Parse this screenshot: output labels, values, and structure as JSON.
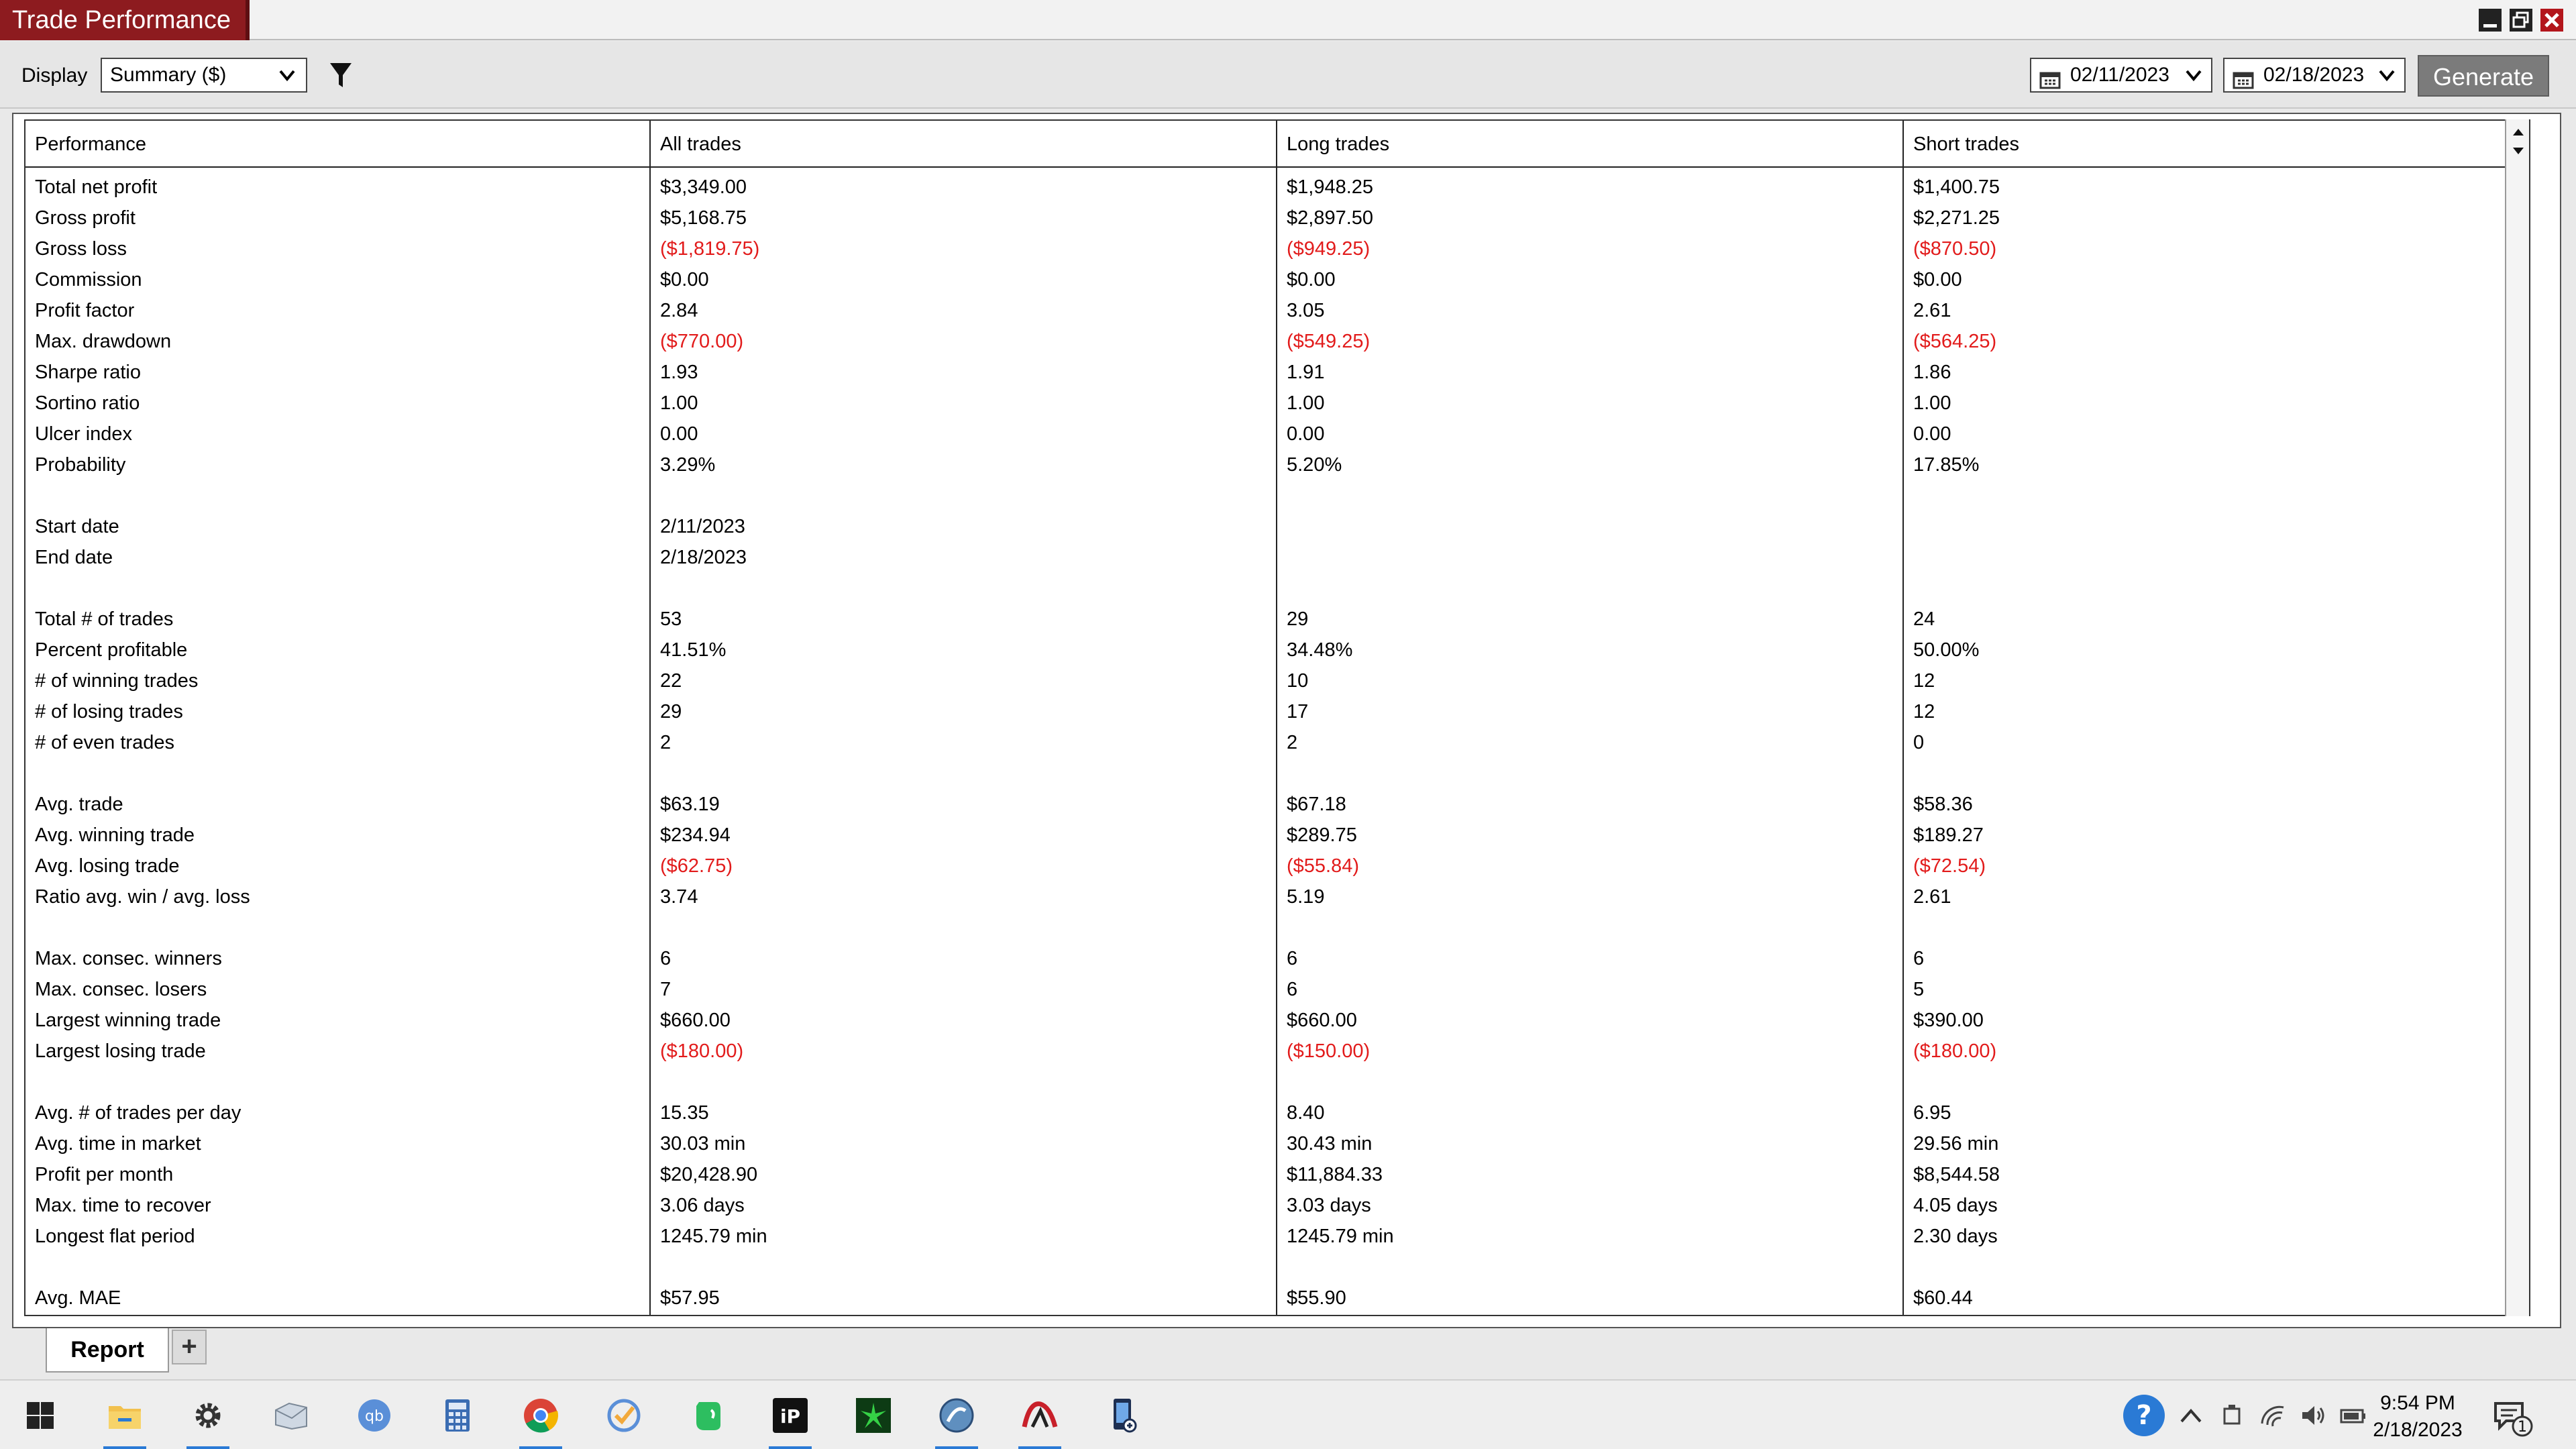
{
  "window": {
    "title": "Trade Performance"
  },
  "toolbar": {
    "display_label": "Display",
    "display_value": "Summary ($)",
    "start_date": "02/11/2023",
    "end_date": "02/18/2023",
    "generate_label": "Generate"
  },
  "table": {
    "headers": [
      "Performance",
      "All trades",
      "Long trades",
      "Short trades"
    ],
    "rows": [
      {
        "label": "Total net profit",
        "all": "$3,349.00",
        "long": "$1,948.25",
        "short": "$1,400.75",
        "neg": false
      },
      {
        "label": "Gross profit",
        "all": "$5,168.75",
        "long": "$2,897.50",
        "short": "$2,271.25",
        "neg": false
      },
      {
        "label": "Gross loss",
        "all": "($1,819.75)",
        "long": "($949.25)",
        "short": "($870.50)",
        "neg": true
      },
      {
        "label": "Commission",
        "all": "$0.00",
        "long": "$0.00",
        "short": "$0.00",
        "neg": false
      },
      {
        "label": "Profit factor",
        "all": "2.84",
        "long": "3.05",
        "short": "2.61",
        "neg": false
      },
      {
        "label": "Max. drawdown",
        "all": "($770.00)",
        "long": "($549.25)",
        "short": "($564.25)",
        "neg": true
      },
      {
        "label": "Sharpe ratio",
        "all": "1.93",
        "long": "1.91",
        "short": "1.86",
        "neg": false
      },
      {
        "label": "Sortino ratio",
        "all": "1.00",
        "long": "1.00",
        "short": "1.00",
        "neg": false
      },
      {
        "label": "Ulcer index",
        "all": "0.00",
        "long": "0.00",
        "short": "0.00",
        "neg": false
      },
      {
        "label": "Probability",
        "all": "3.29%",
        "long": "5.20%",
        "short": "17.85%",
        "neg": false
      },
      {
        "label": "",
        "all": "",
        "long": "",
        "short": "",
        "neg": false
      },
      {
        "label": "Start date",
        "all": "2/11/2023",
        "long": "",
        "short": "",
        "neg": false
      },
      {
        "label": "End date",
        "all": "2/18/2023",
        "long": "",
        "short": "",
        "neg": false
      },
      {
        "label": "",
        "all": "",
        "long": "",
        "short": "",
        "neg": false
      },
      {
        "label": "Total # of trades",
        "all": "53",
        "long": "29",
        "short": "24",
        "neg": false
      },
      {
        "label": "Percent profitable",
        "all": "41.51%",
        "long": "34.48%",
        "short": "50.00%",
        "neg": false
      },
      {
        "label": "# of winning trades",
        "all": "22",
        "long": "10",
        "short": "12",
        "neg": false
      },
      {
        "label": "# of losing trades",
        "all": "29",
        "long": "17",
        "short": "12",
        "neg": false
      },
      {
        "label": "# of even trades",
        "all": "2",
        "long": "2",
        "short": "0",
        "neg": false
      },
      {
        "label": "",
        "all": "",
        "long": "",
        "short": "",
        "neg": false
      },
      {
        "label": "Avg. trade",
        "all": "$63.19",
        "long": "$67.18",
        "short": "$58.36",
        "neg": false
      },
      {
        "label": "Avg. winning trade",
        "all": "$234.94",
        "long": "$289.75",
        "short": "$189.27",
        "neg": false
      },
      {
        "label": "Avg. losing trade",
        "all": "($62.75)",
        "long": "($55.84)",
        "short": "($72.54)",
        "neg": true
      },
      {
        "label": "Ratio avg. win / avg. loss",
        "all": "3.74",
        "long": "5.19",
        "short": "2.61",
        "neg": false
      },
      {
        "label": "",
        "all": "",
        "long": "",
        "short": "",
        "neg": false
      },
      {
        "label": "Max. consec. winners",
        "all": "6",
        "long": "6",
        "short": "6",
        "neg": false
      },
      {
        "label": "Max. consec. losers",
        "all": "7",
        "long": "6",
        "short": "5",
        "neg": false
      },
      {
        "label": "Largest winning trade",
        "all": "$660.00",
        "long": "$660.00",
        "short": "$390.00",
        "neg": false
      },
      {
        "label": "Largest losing trade",
        "all": "($180.00)",
        "long": "($150.00)",
        "short": "($180.00)",
        "neg": true
      },
      {
        "label": "",
        "all": "",
        "long": "",
        "short": "",
        "neg": false
      },
      {
        "label": "Avg. # of trades per day",
        "all": "15.35",
        "long": "8.40",
        "short": "6.95",
        "neg": false
      },
      {
        "label": "Avg. time in market",
        "all": "30.03 min",
        "long": "30.43 min",
        "short": "29.56 min",
        "neg": false
      },
      {
        "label": "Profit per month",
        "all": "$20,428.90",
        "long": "$11,884.33",
        "short": "$8,544.58",
        "neg": false
      },
      {
        "label": "Max. time to recover",
        "all": "3.06 days",
        "long": "3.03 days",
        "short": "4.05 days",
        "neg": false
      },
      {
        "label": "Longest flat period",
        "all": "1245.79 min",
        "long": "1245.79 min",
        "short": "2.30 days",
        "neg": false
      },
      {
        "label": "",
        "all": "",
        "long": "",
        "short": "",
        "neg": false
      },
      {
        "label": "Avg. MAE",
        "all": "$57.95",
        "long": "$55.90",
        "short": "$60.44",
        "neg": false
      }
    ]
  },
  "tabs": {
    "report_label": "Report",
    "add_label": "+"
  },
  "taskbar": {
    "icons": [
      "windows-start",
      "file-explorer",
      "settings",
      "mail",
      "qbittorrent",
      "calculator",
      "chrome",
      "todo",
      "evernote",
      "app-dark",
      "app-green",
      "app-blue-globe",
      "app-red-logo",
      "app-phone"
    ],
    "time": "9:54 PM",
    "date": "2/18/2023",
    "notification_count": "1"
  },
  "colors": {
    "title_bg": "#8d1b1f",
    "negative": "#e21b1b",
    "generate_bg": "#7b7b7b"
  }
}
